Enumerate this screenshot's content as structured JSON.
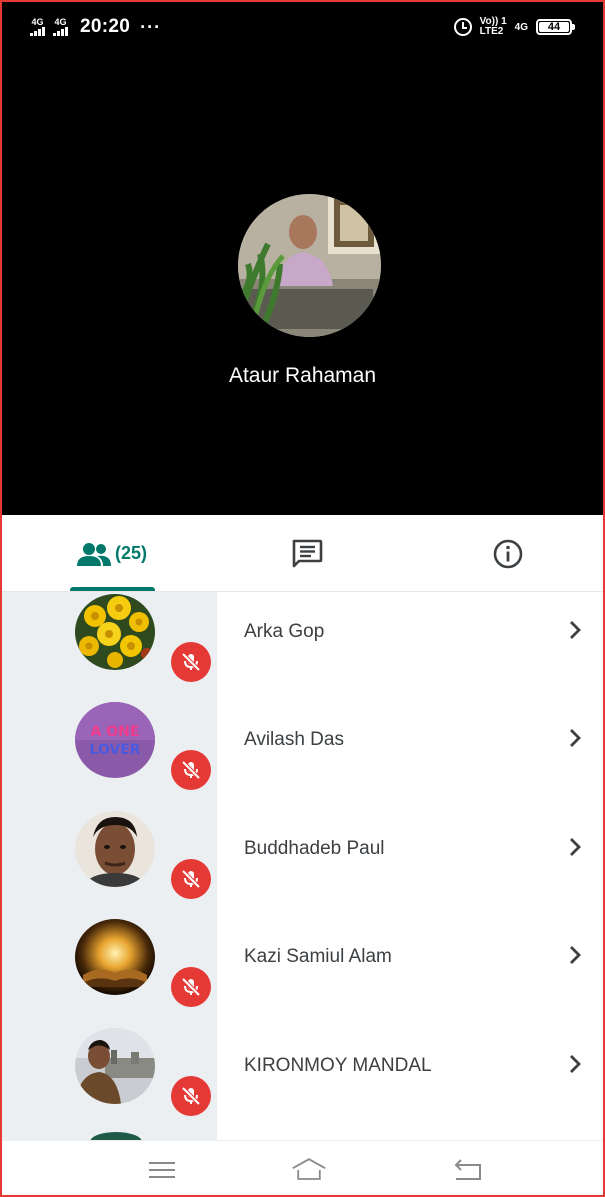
{
  "status_bar": {
    "signal1": "4G",
    "signal2": "4G",
    "time": "20:20",
    "more": "···",
    "volte_top": "Vo)) 1",
    "volte_bottom": "LTE2",
    "net": "4G",
    "battery": "44"
  },
  "presenter": {
    "name": "Ataur Rahaman"
  },
  "tabs": {
    "people_count": "(25)"
  },
  "participants": [
    {
      "name": "Arka Gop"
    },
    {
      "name": "Avilash Das"
    },
    {
      "name": "Buddhadeb Paul"
    },
    {
      "name": "Kazi Samiul Alam"
    },
    {
      "name": "KIRONMOY MANDAL"
    }
  ],
  "avatar_texts": {
    "avilash_line1": "A ONE",
    "avilash_line2": "LOVER"
  },
  "colors": {
    "accent": "#00796b",
    "mute": "#e53935",
    "gutter": "#eceff1"
  },
  "icons": {
    "people": "people-icon",
    "chat": "chat-icon",
    "info": "info-icon",
    "mute": "mic-off-icon",
    "chevron": "chevron-right-icon"
  }
}
